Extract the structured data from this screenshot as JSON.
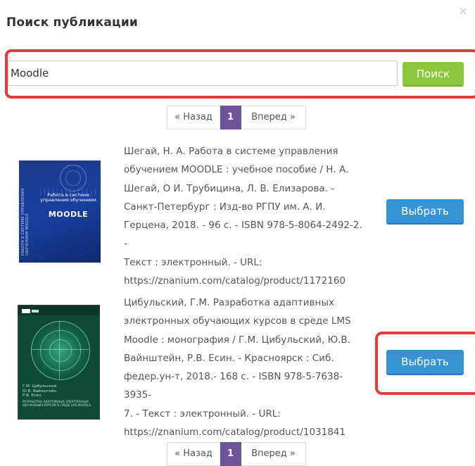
{
  "dialog": {
    "title": "Поиск публикации",
    "close_glyph": "×"
  },
  "search": {
    "value": "Moodle",
    "placeholder": "",
    "button_label": "Поиск"
  },
  "pagination": {
    "prev_label": "« Назад",
    "current_page": "1",
    "next_label": "Вперед »"
  },
  "results": [
    {
      "citation_lines": [
        "Шегай, Н. А. Работа в системе управления",
        "обучением MOODLE : учебное пособие / Н. А.",
        "Шегай, О И. Трубицина, Л. В. Елизарова. -",
        "Санкт-Петербург : Изд-во РГПУ им. А. И.",
        "Герцена, 2018. - 96 с. - ISBN 978-5-8064-2492-2. -",
        "Текст : электронный. - URL:",
        "https://znanium.com/catalog/product/1172160"
      ],
      "cover": {
        "spine": "РАБОТА В СИСТЕМЕ УПРАВЛЕНИЯ ОБУЧЕНИЕМ MOODLE",
        "title_small": "Работа в системе управления обучением",
        "title_big": "MOODLE"
      },
      "button_label": "Выбрать"
    },
    {
      "citation_lines": [
        "Цибульский, Г.М. Разработка адаптивных",
        "электронных обучающих курсов в среде LMS",
        "Moodle : монография / Г.М. Цибульский, Ю.В.",
        "Вайнштейн, Р.В. Есин. - Красноярск : Сиб.",
        "федер.ун-т, 2018.- 168 с. - ISBN 978-5-7638-3935-",
        "7. - Текст : электронный. - URL:",
        "https://znanium.com/catalog/product/1031841"
      ],
      "cover": {
        "authors": "Г.М. Цибульский\nЮ.В. Вайнштейн\nР.В. Есин",
        "title": "Разработка адаптивных электронных обучающих курсов в среде LMS Moodle"
      },
      "button_label": "Выбрать"
    }
  ],
  "colors": {
    "search_button": "#8dc63f",
    "select_button": "#3593d3",
    "page_active": "#6f5499",
    "highlight": "#e03c3c"
  },
  "icons": [
    "close-icon"
  ]
}
